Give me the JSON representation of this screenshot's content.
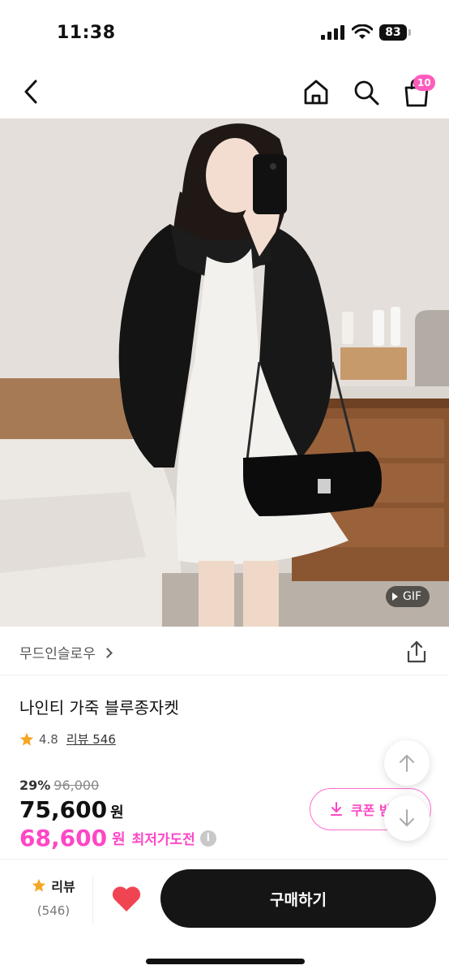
{
  "status_bar": {
    "time": "11:38",
    "battery": "83"
  },
  "nav": {
    "cart_count": "10"
  },
  "hero": {
    "gif_label": "GIF"
  },
  "brand": {
    "name": "무드인슬로우"
  },
  "product": {
    "title": "나인티 가죽 블루종자켓",
    "rating": "4.8",
    "review_link": "리뷰 546"
  },
  "price": {
    "discount": "29%",
    "original": "96,000",
    "sale": "75,600",
    "won": "원",
    "lowest": "68,600",
    "lowest_label": "최저가도전",
    "info_icon": "i"
  },
  "coupon": {
    "label": "쿠폰 받"
  },
  "bottom": {
    "review_label": "리뷰",
    "review_count": "(546)",
    "buy_label": "구매하기"
  },
  "colors": {
    "accent": "#ff46c5",
    "star": "#f5a623",
    "heart": "#f04452",
    "buy": "#151515"
  }
}
